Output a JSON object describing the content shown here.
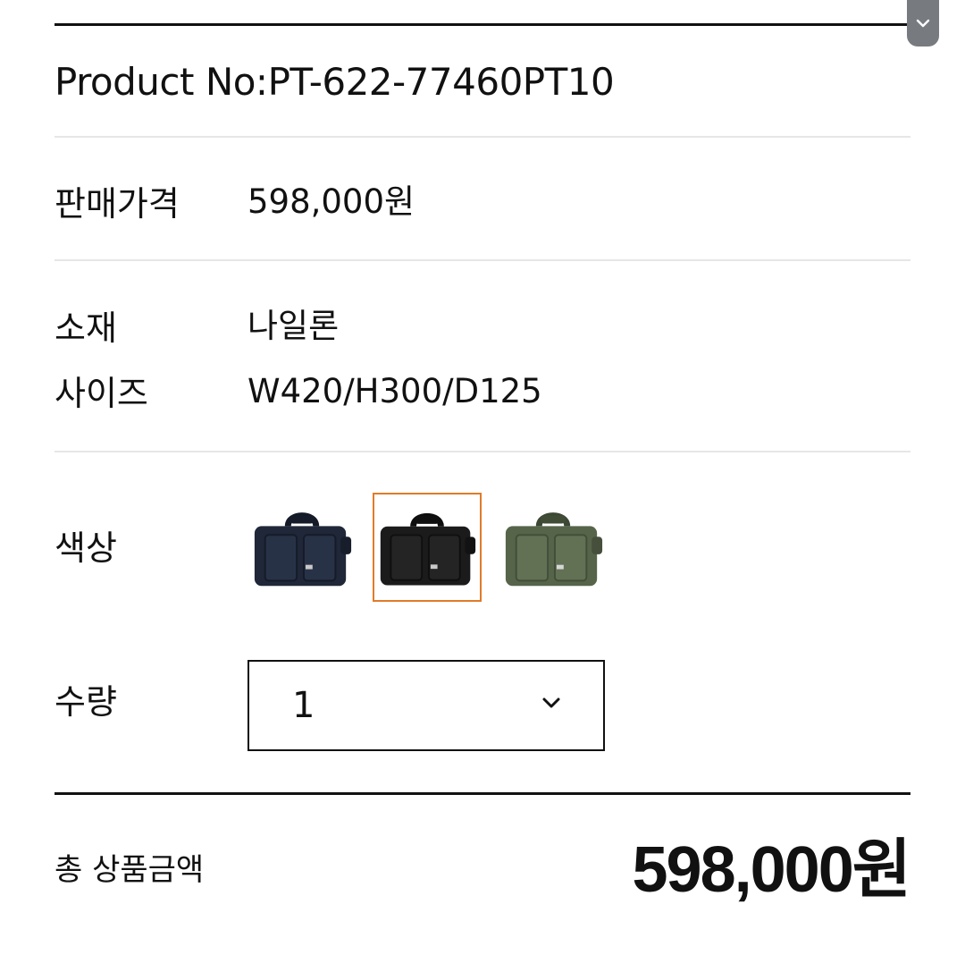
{
  "product": {
    "number": "Product No:PT-622-77460PT10"
  },
  "price": {
    "label": "판매가격",
    "value": "598,000원"
  },
  "material": {
    "label": "소재",
    "value": "나일론"
  },
  "size": {
    "label": "사이즈",
    "value": "W420/H300/D125"
  },
  "color": {
    "label": "색상",
    "options": [
      {
        "name": "navy",
        "hex": "#1f2738"
      },
      {
        "name": "black",
        "hex": "#1b1b1b",
        "selected": true
      },
      {
        "name": "olive",
        "hex": "#56644a"
      }
    ],
    "selected_border": "#e07b2a"
  },
  "quantity": {
    "label": "수량",
    "value": "1"
  },
  "total": {
    "label": "총 상품금액",
    "value": "598,000원"
  },
  "icons": {
    "scroll_toggle": "chevron-down-icon",
    "quantity_dropdown": "chevron-down-icon"
  }
}
